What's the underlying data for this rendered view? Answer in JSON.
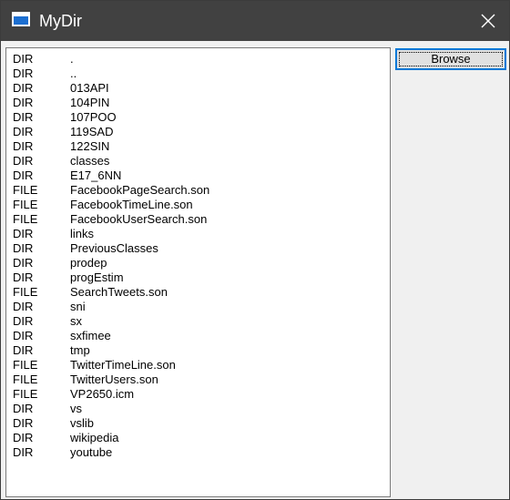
{
  "window": {
    "title": "MyDir",
    "icon": "app-window-icon",
    "close_icon": "close-icon"
  },
  "browse_button": {
    "label": "Browse"
  },
  "listing": [
    {
      "type": "DIR",
      "name": "."
    },
    {
      "type": "DIR",
      "name": ".."
    },
    {
      "type": "DIR",
      "name": "013API"
    },
    {
      "type": "DIR",
      "name": "104PIN"
    },
    {
      "type": "DIR",
      "name": "107POO"
    },
    {
      "type": "DIR",
      "name": "119SAD"
    },
    {
      "type": "DIR",
      "name": "122SIN"
    },
    {
      "type": "DIR",
      "name": "classes"
    },
    {
      "type": "DIR",
      "name": "E17_6NN"
    },
    {
      "type": "FILE",
      "name": "FacebookPageSearch.son"
    },
    {
      "type": "FILE",
      "name": "FacebookTimeLine.son"
    },
    {
      "type": "FILE",
      "name": "FacebookUserSearch.son"
    },
    {
      "type": "DIR",
      "name": "links"
    },
    {
      "type": "DIR",
      "name": "PreviousClasses"
    },
    {
      "type": "DIR",
      "name": "prodep"
    },
    {
      "type": "DIR",
      "name": "progEstim"
    },
    {
      "type": "FILE",
      "name": "SearchTweets.son"
    },
    {
      "type": "DIR",
      "name": "sni"
    },
    {
      "type": "DIR",
      "name": "sx"
    },
    {
      "type": "DIR",
      "name": "sxfimee"
    },
    {
      "type": "DIR",
      "name": "tmp"
    },
    {
      "type": "FILE",
      "name": "TwitterTimeLine.son"
    },
    {
      "type": "FILE",
      "name": "TwitterUsers.son"
    },
    {
      "type": "FILE",
      "name": "VP2650.icm"
    },
    {
      "type": "DIR",
      "name": "vs"
    },
    {
      "type": "DIR",
      "name": "vslib"
    },
    {
      "type": "DIR",
      "name": "wikipedia"
    },
    {
      "type": "DIR",
      "name": "youtube"
    }
  ],
  "colors": {
    "titlebar": "#414141",
    "accent": "#0078d7",
    "window_bg": "#f0f0f0"
  }
}
